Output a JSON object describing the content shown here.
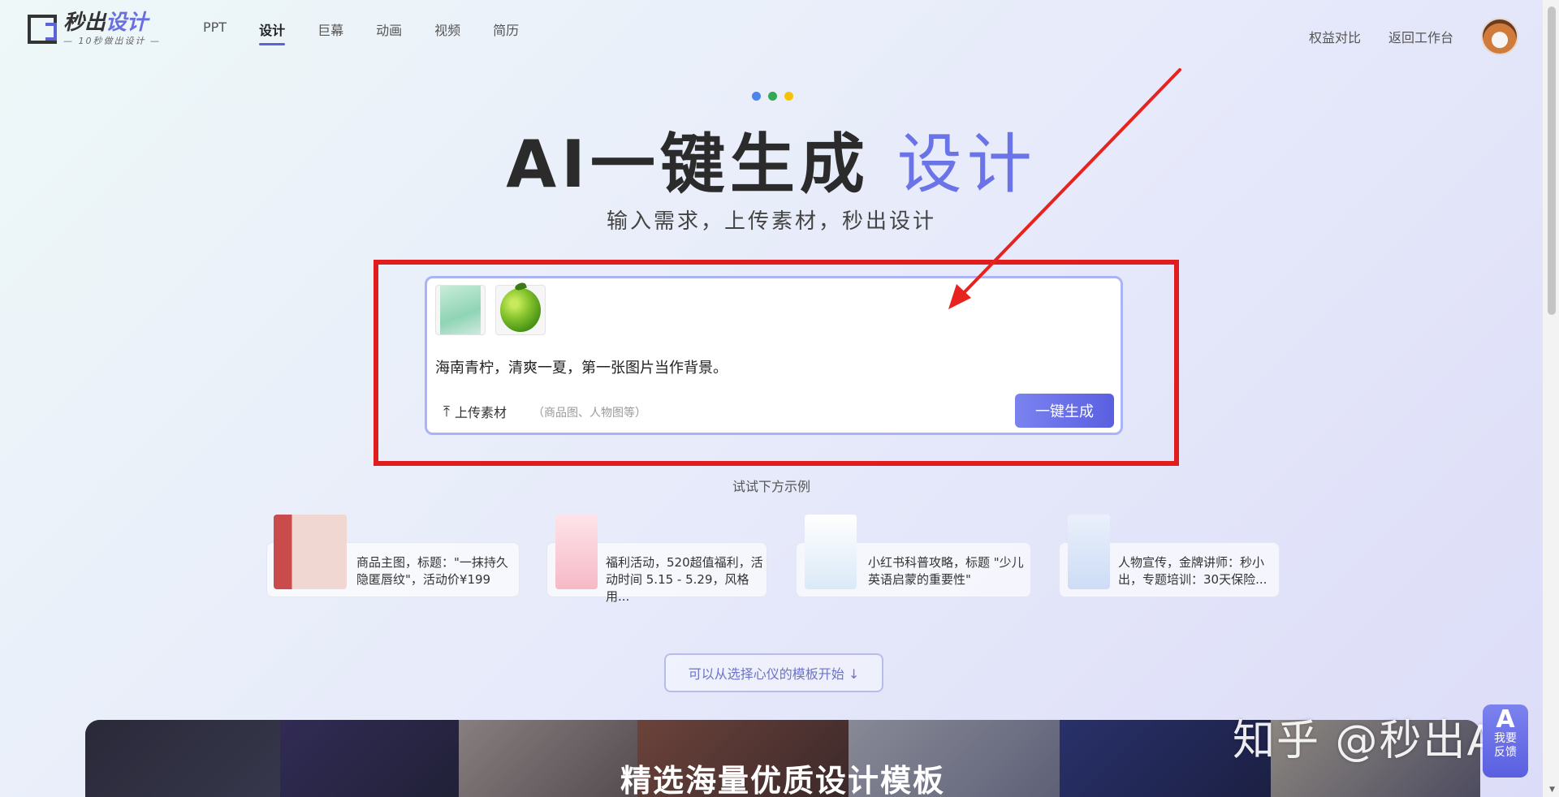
{
  "logo": {
    "title_main": "秒出",
    "title_accent": "设计",
    "subtitle": "10秒做出设计"
  },
  "nav": {
    "items": [
      {
        "label": "PPT",
        "active": false
      },
      {
        "label": "设计",
        "active": true
      },
      {
        "label": "巨幕",
        "active": false
      },
      {
        "label": "动画",
        "active": false
      },
      {
        "label": "视频",
        "active": false
      },
      {
        "label": "简历",
        "active": false
      }
    ],
    "right_links": [
      "权益对比",
      "返回工作台"
    ]
  },
  "hero": {
    "dot_colors": [
      "#4a86e8",
      "#34a853",
      "#f4c20d"
    ],
    "title_main": "AI一键生成",
    "title_accent": "设计",
    "subtitle": "输入需求，上传素材，秒出设计"
  },
  "input": {
    "prompt": "海南青柠，清爽一夏，第一张图片当作背景。",
    "upload_label": "上传素材",
    "upload_hint": "（商品图、人物图等）",
    "generate_label": "一键生成"
  },
  "examples": {
    "label": "试试下方示例",
    "items": [
      {
        "line1": "商品主图，标题：\"一抹持久",
        "line2": "隐匿唇纹\"，活动价¥199"
      },
      {
        "line1": "福利活动，520超值福利，活",
        "line2": "动时间 5.15 - 5.29，风格用..."
      },
      {
        "line1": "小红书科普攻略，标题 \"少儿",
        "line2": "英语启蒙的重要性\""
      },
      {
        "line1": "人物宣传，金牌讲师：秒小",
        "line2": "出，专题培训：30天保险..."
      }
    ]
  },
  "template_button": "可以从选择心仪的模板开始 ↓",
  "banner": {
    "title": "精选海量优质设计模板"
  },
  "watermark": "知乎 @秒出AI",
  "feedback": {
    "logo": "A",
    "label_1": "我要",
    "label_2": "反馈"
  },
  "colors": {
    "accent": "#5b63d6",
    "highlight_frame": "#e01d1d",
    "annotation_arrow": "#e8231f"
  }
}
